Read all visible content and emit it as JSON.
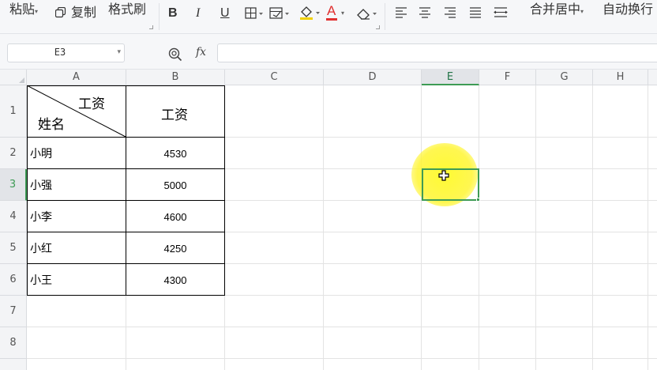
{
  "toolbar": {
    "paste_label": "粘贴",
    "copy_label": "复制",
    "format_painter_label": "格式刷",
    "bold_label": "B",
    "italic_label": "I",
    "underline_label": "U",
    "font_color_label": "A",
    "merge_center_label": "合并居中",
    "wrap_text_label": "自动换行",
    "font_color": "#e03030",
    "fill_color": "#f0d000"
  },
  "formula_bar": {
    "cell_reference": "E3",
    "fx_label": "fx",
    "formula_value": ""
  },
  "columns": [
    "A",
    "B",
    "C",
    "D",
    "E",
    "F",
    "G",
    "H"
  ],
  "rows": [
    "1",
    "2",
    "3",
    "4",
    "5",
    "6",
    "7",
    "8"
  ],
  "active_column": "E",
  "active_row": "3",
  "table": {
    "header_top_right": "工资",
    "header_bottom_left": "姓名",
    "header_b": "工资",
    "names": [
      "小明",
      "小强",
      "小李",
      "小红",
      "小王"
    ],
    "salaries": [
      "4530",
      "5000",
      "4600",
      "4250",
      "4300"
    ]
  },
  "colors": {
    "accent_green": "#3e9b55",
    "highlight_yellow": "#fff22a"
  }
}
